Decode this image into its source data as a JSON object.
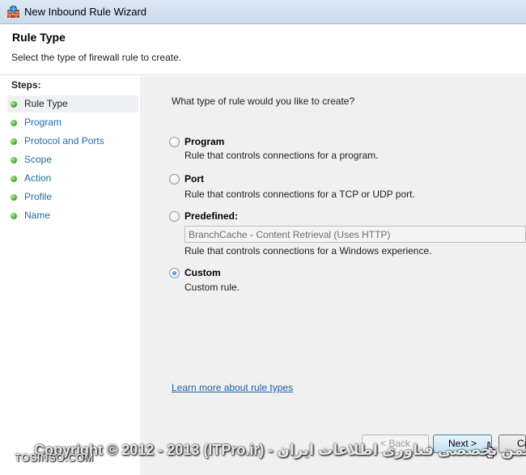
{
  "window": {
    "title": "New Inbound Rule Wizard"
  },
  "header": {
    "title": "Rule Type",
    "subtitle": "Select the type of firewall rule to create."
  },
  "steps": {
    "title": "Steps:",
    "items": [
      {
        "label": "Rule Type"
      },
      {
        "label": "Program"
      },
      {
        "label": "Protocol and Ports"
      },
      {
        "label": "Scope"
      },
      {
        "label": "Action"
      },
      {
        "label": "Profile"
      },
      {
        "label": "Name"
      }
    ]
  },
  "content": {
    "question": "What type of rule would you like to create?",
    "options": [
      {
        "label": "Program",
        "description": "Rule that controls connections for a program.",
        "selected": false
      },
      {
        "label": "Port",
        "description": "Rule that controls connections for a TCP or UDP port.",
        "selected": false
      },
      {
        "label": "Predefined:",
        "description": "Rule that controls connections for a Windows experience.",
        "selected": false
      },
      {
        "label": "Custom",
        "description": "Custom rule.",
        "selected": true
      }
    ],
    "predefined_value": "BranchCache - Content Retrieval (Uses HTTP)",
    "learn_more_link": "Learn more about rule types"
  },
  "buttons": {
    "back": "< Back",
    "next": "Next >",
    "cancel": "Ca"
  },
  "watermark": {
    "copyright": "Copyright © 2012 - 2013 (ITPro.ir) - انجمن تخصصی فناوری اطلاعات ایران",
    "site": "TOSINSO.COM"
  },
  "colors": {
    "link": "#1f6aab",
    "pane_bg": "#f0f0f0",
    "active_step_bg": "#eef0f2"
  }
}
